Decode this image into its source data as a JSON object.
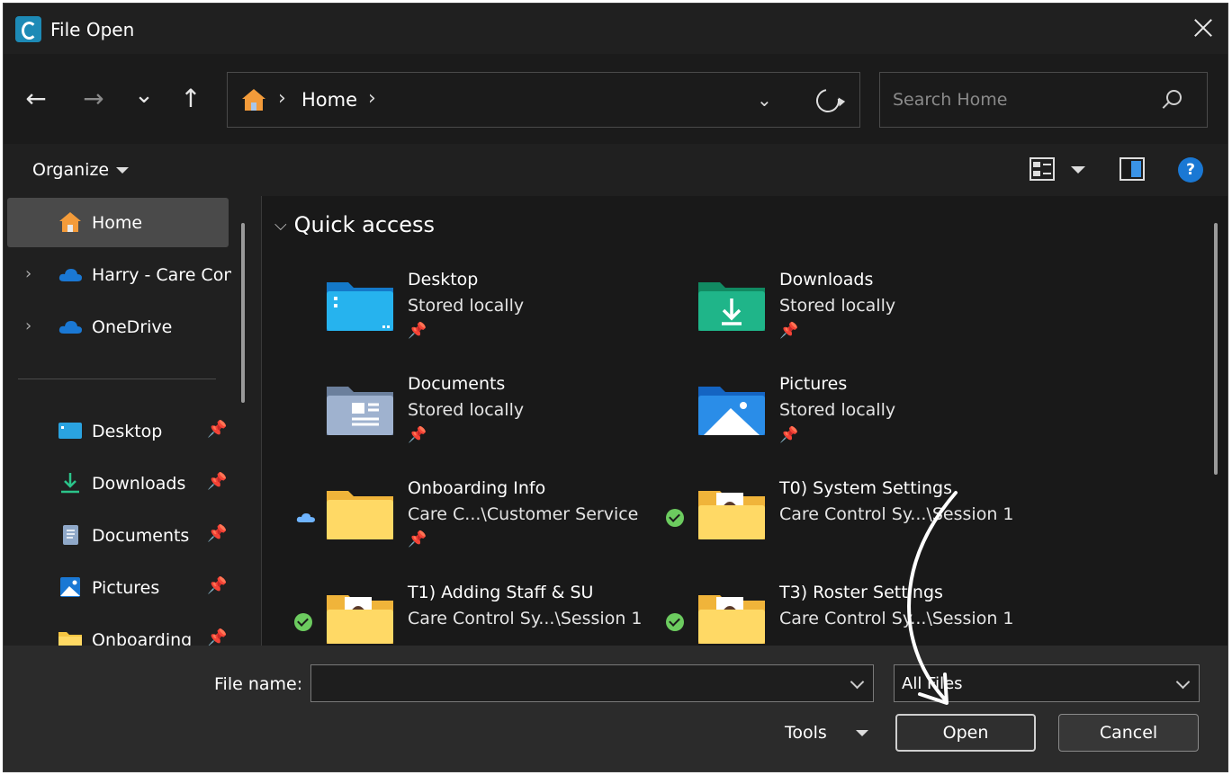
{
  "window": {
    "title": "File Open"
  },
  "navigation": {
    "back": "←",
    "forward": "→",
    "recent": "⌄",
    "up": "↑",
    "breadcrumb": [
      "Home"
    ],
    "search_placeholder": "Search Home"
  },
  "toolbar": {
    "organize_label": "Organize"
  },
  "sidebar": {
    "items": [
      {
        "label": "Home",
        "icon": "home-icon",
        "selected": true
      },
      {
        "label": "Harry - Care Control Systems",
        "icon": "cloud-icon",
        "expandable": true
      },
      {
        "label": "OneDrive",
        "icon": "cloud-icon",
        "expandable": true
      }
    ],
    "pinned": [
      {
        "label": "Desktop",
        "icon": "desktop-icon"
      },
      {
        "label": "Downloads",
        "icon": "download-icon"
      },
      {
        "label": "Documents",
        "icon": "document-icon"
      },
      {
        "label": "Pictures",
        "icon": "pictures-icon"
      },
      {
        "label": "Onboarding",
        "icon": "folder-icon"
      }
    ]
  },
  "main": {
    "section_title": "Quick access",
    "tiles": [
      {
        "name": "Desktop",
        "location": "Stored locally",
        "pinned": true,
        "icon": "desktop-folder-icon"
      },
      {
        "name": "Downloads",
        "location": "Stored locally",
        "pinned": true,
        "icon": "downloads-folder-icon"
      },
      {
        "name": "Documents",
        "location": "Stored locally",
        "pinned": true,
        "icon": "documents-folder-icon"
      },
      {
        "name": "Pictures",
        "location": "Stored locally",
        "pinned": true,
        "icon": "pictures-folder-icon"
      },
      {
        "name": "Onboarding Info",
        "location": "Care C...\\Customer Service",
        "pinned": true,
        "status": "cloud",
        "icon": "folder-icon"
      },
      {
        "name": "T0) System Settings",
        "location": "Care Control Sy...\\Session 1",
        "pinned": false,
        "status": "synced",
        "icon": "folder-icon"
      },
      {
        "name": "T1) Adding Staff & SU",
        "location": "Care Control Sy...\\Session 1",
        "pinned": false,
        "status": "synced",
        "icon": "folder-icon"
      },
      {
        "name": "T3) Roster Settings",
        "location": "Care Control Sy...\\Session 1",
        "pinned": false,
        "status": "synced",
        "icon": "folder-icon"
      }
    ]
  },
  "footer": {
    "file_name_label": "File name:",
    "file_name_value": "",
    "file_type": "All Files",
    "tools_label": "Tools",
    "open_label": "Open",
    "cancel_label": "Cancel"
  },
  "colors": {
    "accent": "#1a78d4",
    "folder": "#f5c542",
    "synced": "#6ccb5f"
  }
}
